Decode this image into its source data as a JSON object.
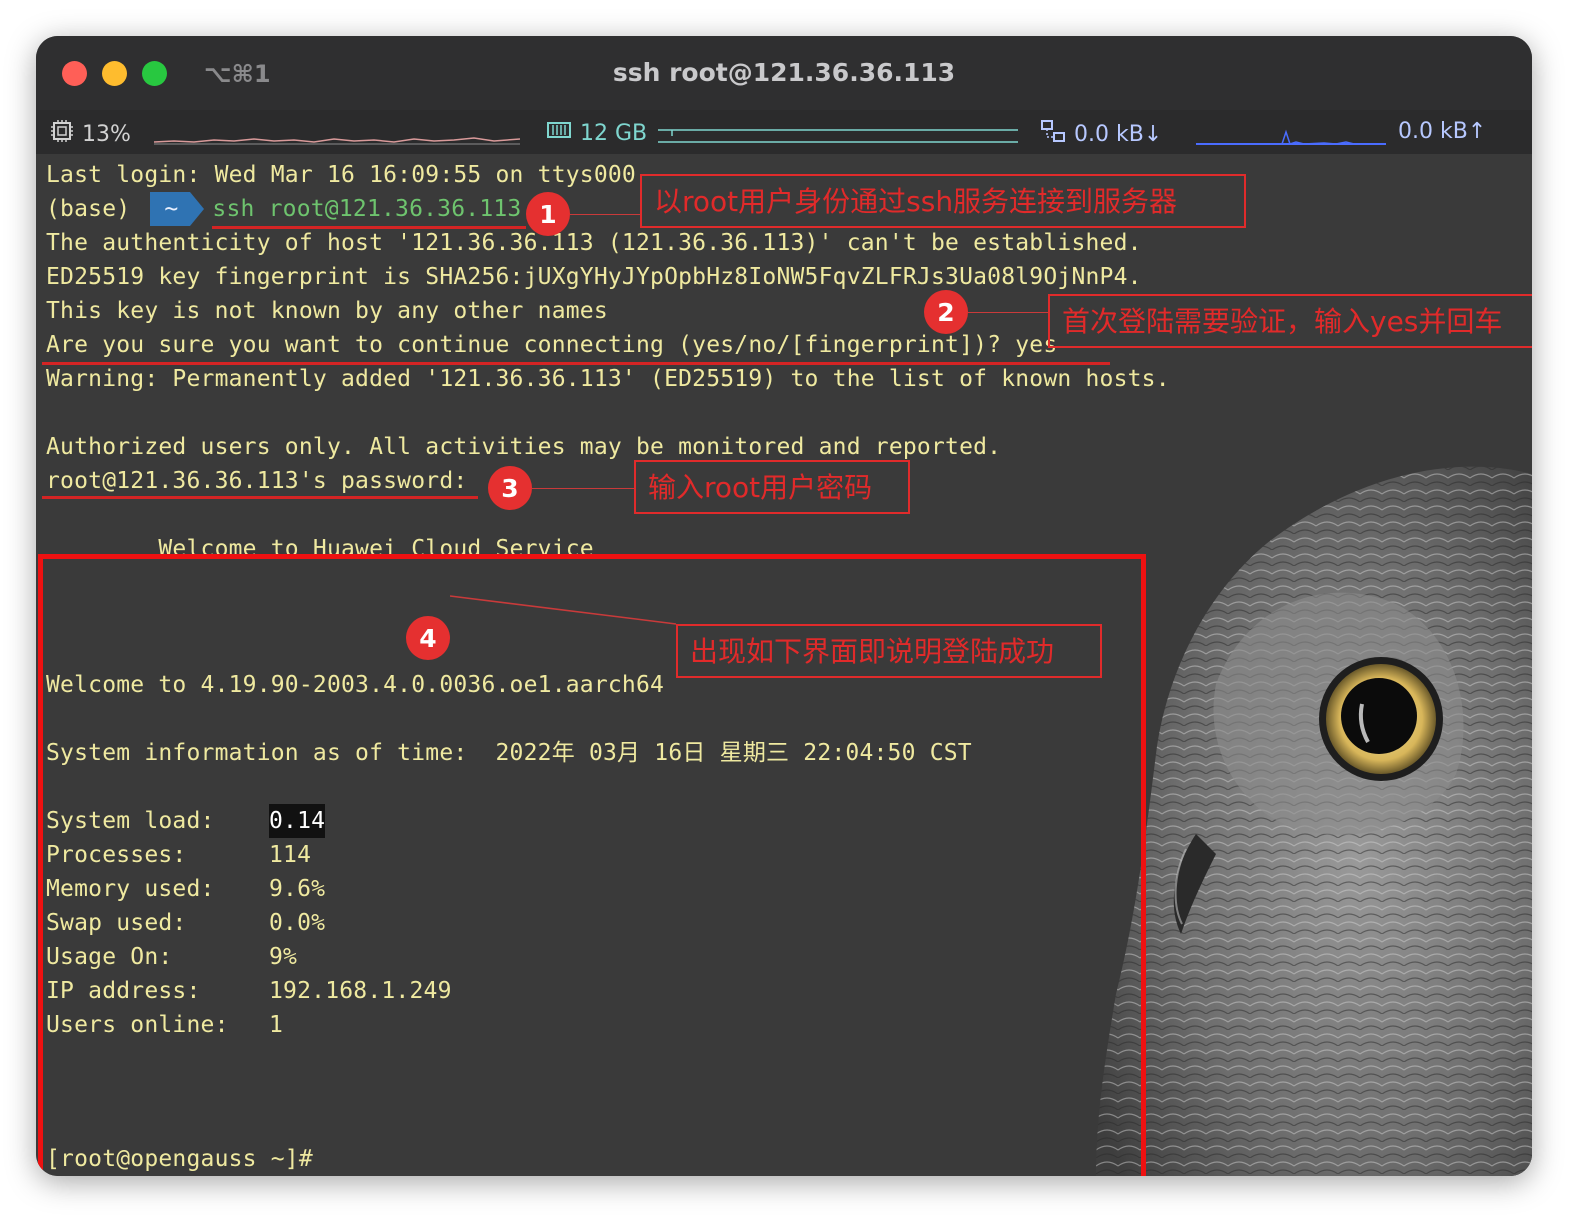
{
  "window": {
    "shortcut": "⌥⌘1",
    "title": "ssh root@121.36.36.113"
  },
  "statusbar": {
    "cpu": "13%",
    "memory": "12 GB",
    "net_down": "0.0 kB↓",
    "net_up": "0.0 kB↑",
    "icons": [
      "cpu-icon",
      "memory-icon",
      "network-icon"
    ]
  },
  "terminal": {
    "last_login": "Last login: Wed Mar 16 16:09:55 on ttys000",
    "prompt_env": "(base)",
    "prompt_dir": "~",
    "command": "ssh root@121.36.36.113",
    "lines": [
      "The authenticity of host '121.36.36.113 (121.36.36.113)' can't be established.",
      "ED25519 key fingerprint is SHA256:jUXgYHyJYpOpbHz8IoNW5FqvZLFRJs3Ua08l9OjNnP4.",
      "This key is not known by any other names",
      "Are you sure you want to continue connecting (yes/no/[fingerprint])? yes",
      "Warning: Permanently added '121.36.36.113' (ED25519) to the list of known hosts.",
      "",
      "Authorized users only. All activities may be monitored and reported.",
      "root@121.36.36.113's password:"
    ],
    "welcome_service": "        Welcome to Huawei Cloud Service",
    "welcome_kernel": "Welcome to 4.19.90-2003.4.0.0036.oe1.aarch64",
    "sysinfo_time": "System information as of time:  2022年 03月 16日 星期三 22:04:50 CST",
    "sysinfo": [
      {
        "label": "System load:",
        "value": "0.14"
      },
      {
        "label": "Processes:",
        "value": "114"
      },
      {
        "label": "Memory used:",
        "value": "9.6%"
      },
      {
        "label": "Swap used:",
        "value": "0.0%"
      },
      {
        "label": "Usage On:",
        "value": "9%"
      },
      {
        "label": "IP address:",
        "value": "192.168.1.249"
      },
      {
        "label": "Users online:",
        "value": "1"
      }
    ],
    "final_prompt": "[root@opengauss ~]#"
  },
  "annotations": [
    {
      "number": "1",
      "text": "以root用户身份通过ssh服务连接到服务器"
    },
    {
      "number": "2",
      "text": "首次登陆需要验证，输入yes并回车"
    },
    {
      "number": "3",
      "text": "输入root用户密码"
    },
    {
      "number": "4",
      "text": "出现如下界面即说明登陆成功"
    }
  ],
  "colors": {
    "terminal_bg": "#3a3a3a",
    "text": "#efe9a0",
    "annotation_red": "#e12a2a",
    "prompt_blue": "#2f73b3",
    "command_green": "#6ec46e"
  }
}
